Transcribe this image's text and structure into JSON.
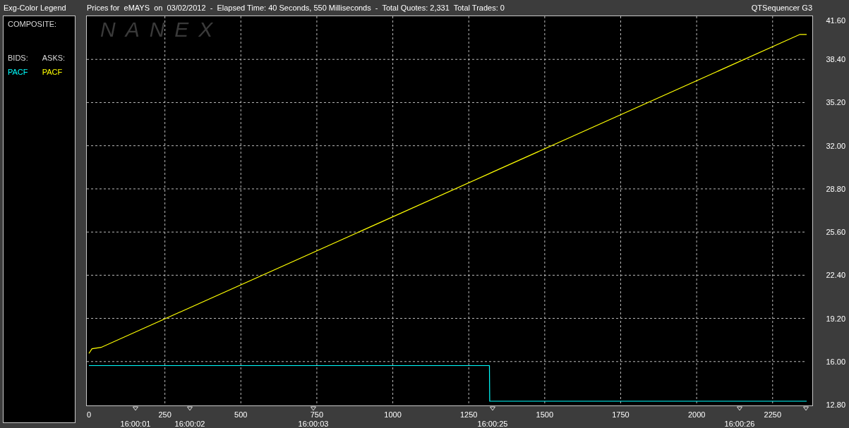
{
  "header": {
    "legend_title": "Exg-Color Legend",
    "chart_title": "Prices for  eMAYS  on  03/02/2012  -  Elapsed Time: 40 Seconds, 550 Milliseconds  -  Total Quotes: 2,331  Total Trades: 0",
    "app_name": "QTSequencer G3"
  },
  "legend": {
    "composite_label": "COMPOSITE:",
    "columns": [
      {
        "heading": "BIDS:",
        "items": [
          {
            "label": "PACF",
            "color": "#00ffff"
          }
        ]
      },
      {
        "heading": "ASKS:",
        "items": [
          {
            "label": "PACF",
            "color": "#ffff00"
          }
        ]
      }
    ]
  },
  "chart": {
    "logo": "NANEX",
    "chart_data": {
      "type": "line",
      "x": [
        0,
        10,
        40,
        1318,
        1319,
        2340,
        2362
      ],
      "series": [
        {
          "color": "#00ffff",
          "values": [
            15.7,
            15.7,
            15.7,
            15.7,
            13.06,
            13.06,
            13.06
          ]
        },
        {
          "color": "#ffff00",
          "values": [
            16.6,
            16.95,
            17.05,
            29.94,
            29.95,
            40.25,
            40.25
          ]
        }
      ],
      "grid": true,
      "xlim": [
        0,
        2362
      ],
      "ylim": [
        12.8,
        41.6
      ],
      "xticks": [
        0,
        250,
        500,
        750,
        1000,
        1250,
        1500,
        1750,
        2000,
        2250
      ],
      "annotations": [
        "16:00:01",
        "16:00:02",
        "16:00:03",
        "16:00:25",
        "16:00:26"
      ],
      "yticks": [
        {
          "value": 12.8,
          "label": "12.80"
        },
        {
          "value": 16,
          "label": "16.00"
        },
        {
          "value": 19.2,
          "label": "19.20"
        },
        {
          "value": 22.4,
          "label": "22.40"
        },
        {
          "value": 25.6,
          "label": "25.60"
        },
        {
          "value": 28.8,
          "label": "28.80"
        },
        {
          "value": 32,
          "label": "32.00"
        },
        {
          "value": 35.2,
          "label": "35.20"
        },
        {
          "value": 38.4,
          "label": "38.40"
        },
        {
          "value": 41.6,
          "label": "41.60"
        }
      ]
    }
  }
}
